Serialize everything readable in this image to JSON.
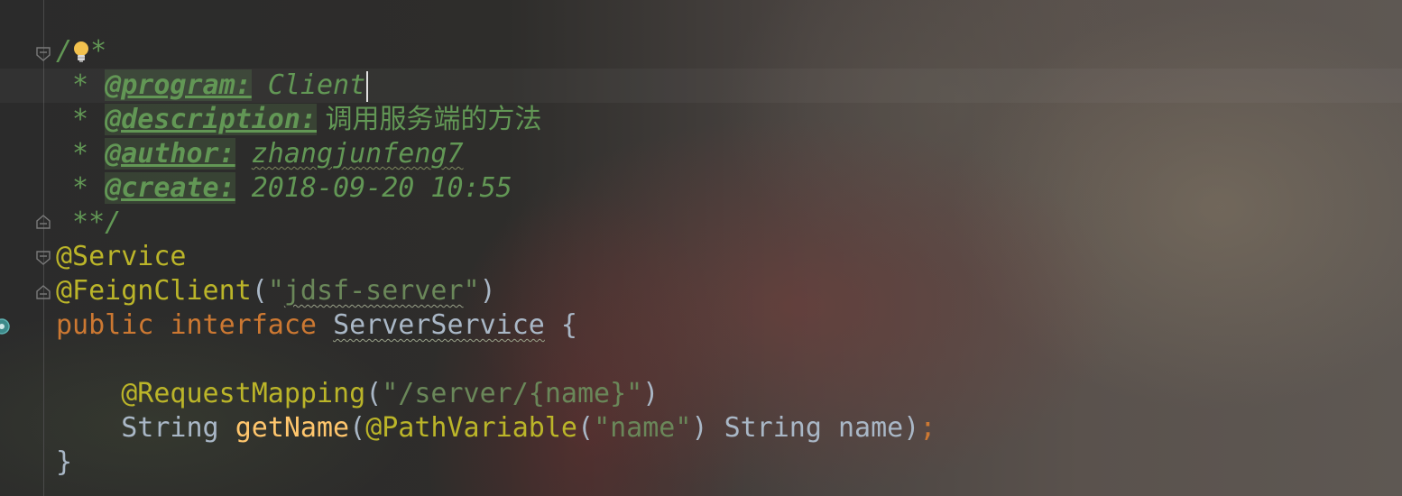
{
  "comment": {
    "open": "/",
    "open_star": "*",
    "star": " * ",
    "program_tag": "@program:",
    "program_value": " Client",
    "description_tag": "@description:",
    "description_value": " 调用服务端的方法",
    "author_tag": "@author:",
    "author_value": "zhangjunfeng7",
    "create_tag": "@create:",
    "create_value": " 2018-09-20 10:55",
    "close": " **/"
  },
  "code": {
    "service_annotation": "@Service",
    "feign_annotation": "@FeignClient",
    "paren_open": "(",
    "feign_quote_open": "\"",
    "feign_value": "jdsf-server",
    "feign_quote_close": "\"",
    "paren_close": ")",
    "kw_public": "public",
    "kw_interface": "interface",
    "interface_name": "ServerService",
    "brace_open": " {",
    "indent": "    ",
    "request_mapping": "@RequestMapping",
    "request_mapping_value": "\"/server/{name}\"",
    "return_type": "String",
    "method_name": "getName",
    "path_variable": "@PathVariable",
    "path_variable_value": "\"name\"",
    "param_type": "String",
    "param_name": "name",
    "semicolon": ";",
    "brace_close": "}"
  },
  "icons": {
    "intention": "lightbulb-icon",
    "implemented": "implemented-interface-icon",
    "fold": "fold-marker-icon"
  },
  "colors": {
    "doc_comment": "#629755",
    "annotation": "#bbb529",
    "string": "#6a8759",
    "keyword": "#cc7832",
    "method": "#ffc66d",
    "identifier": "#a9b7c6"
  }
}
